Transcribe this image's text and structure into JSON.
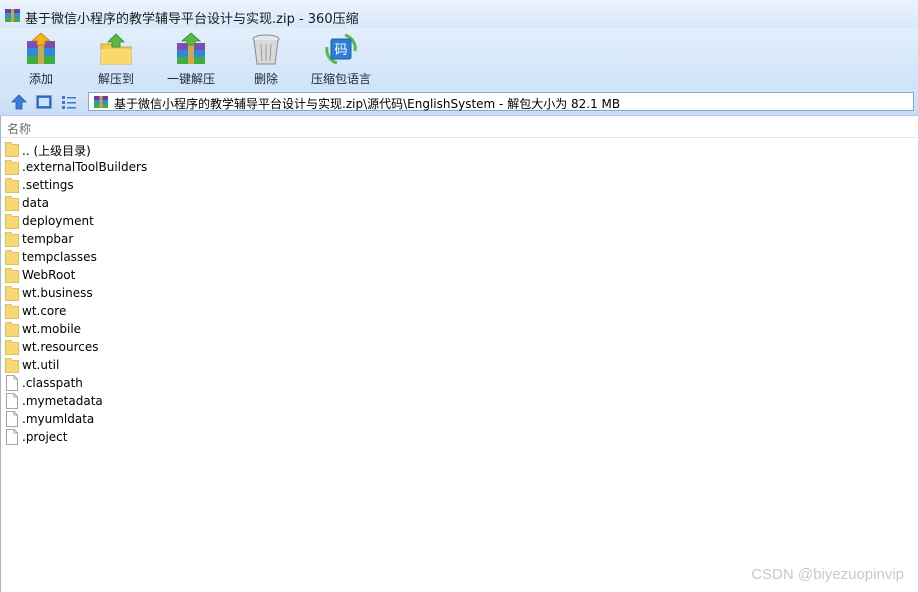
{
  "window": {
    "title": "基于微信小程序的教学辅导平台设计与实现.zip - 360压缩"
  },
  "toolbar": {
    "buttons": [
      {
        "label": "添加",
        "icon": "add-archive-icon"
      },
      {
        "label": "解压到",
        "icon": "extract-to-icon"
      },
      {
        "label": "一键解压",
        "icon": "one-click-extract-icon"
      },
      {
        "label": "删除",
        "icon": "delete-trash-icon"
      },
      {
        "label": "压缩包语言",
        "icon": "archive-language-icon"
      }
    ],
    "language_icon_glyph": "码"
  },
  "navbar": {
    "address": "基于微信小程序的教学辅导平台设计与实现.zip\\源代码\\EnglishSystem - 解包大小为 82.1 MB"
  },
  "filelist": {
    "column_name": "名称",
    "items": [
      {
        "name": ".. (上级目录)",
        "type": "folder"
      },
      {
        "name": ".externalToolBuilders",
        "type": "folder"
      },
      {
        "name": ".settings",
        "type": "folder"
      },
      {
        "name": "data",
        "type": "folder"
      },
      {
        "name": "deployment",
        "type": "folder"
      },
      {
        "name": "tempbar",
        "type": "folder"
      },
      {
        "name": "tempclasses",
        "type": "folder"
      },
      {
        "name": "WebRoot",
        "type": "folder"
      },
      {
        "name": "wt.business",
        "type": "folder"
      },
      {
        "name": "wt.core",
        "type": "folder"
      },
      {
        "name": "wt.mobile",
        "type": "folder"
      },
      {
        "name": "wt.resources",
        "type": "folder"
      },
      {
        "name": "wt.util",
        "type": "folder"
      },
      {
        "name": ".classpath",
        "type": "file"
      },
      {
        "name": ".mymetadata",
        "type": "file"
      },
      {
        "name": ".myumldata",
        "type": "file"
      },
      {
        "name": ".project",
        "type": "file"
      }
    ]
  },
  "watermark": "CSDN @biyezuopinvip",
  "colors": {
    "folder": "#f8d775",
    "accent": "#3a7bd5"
  }
}
